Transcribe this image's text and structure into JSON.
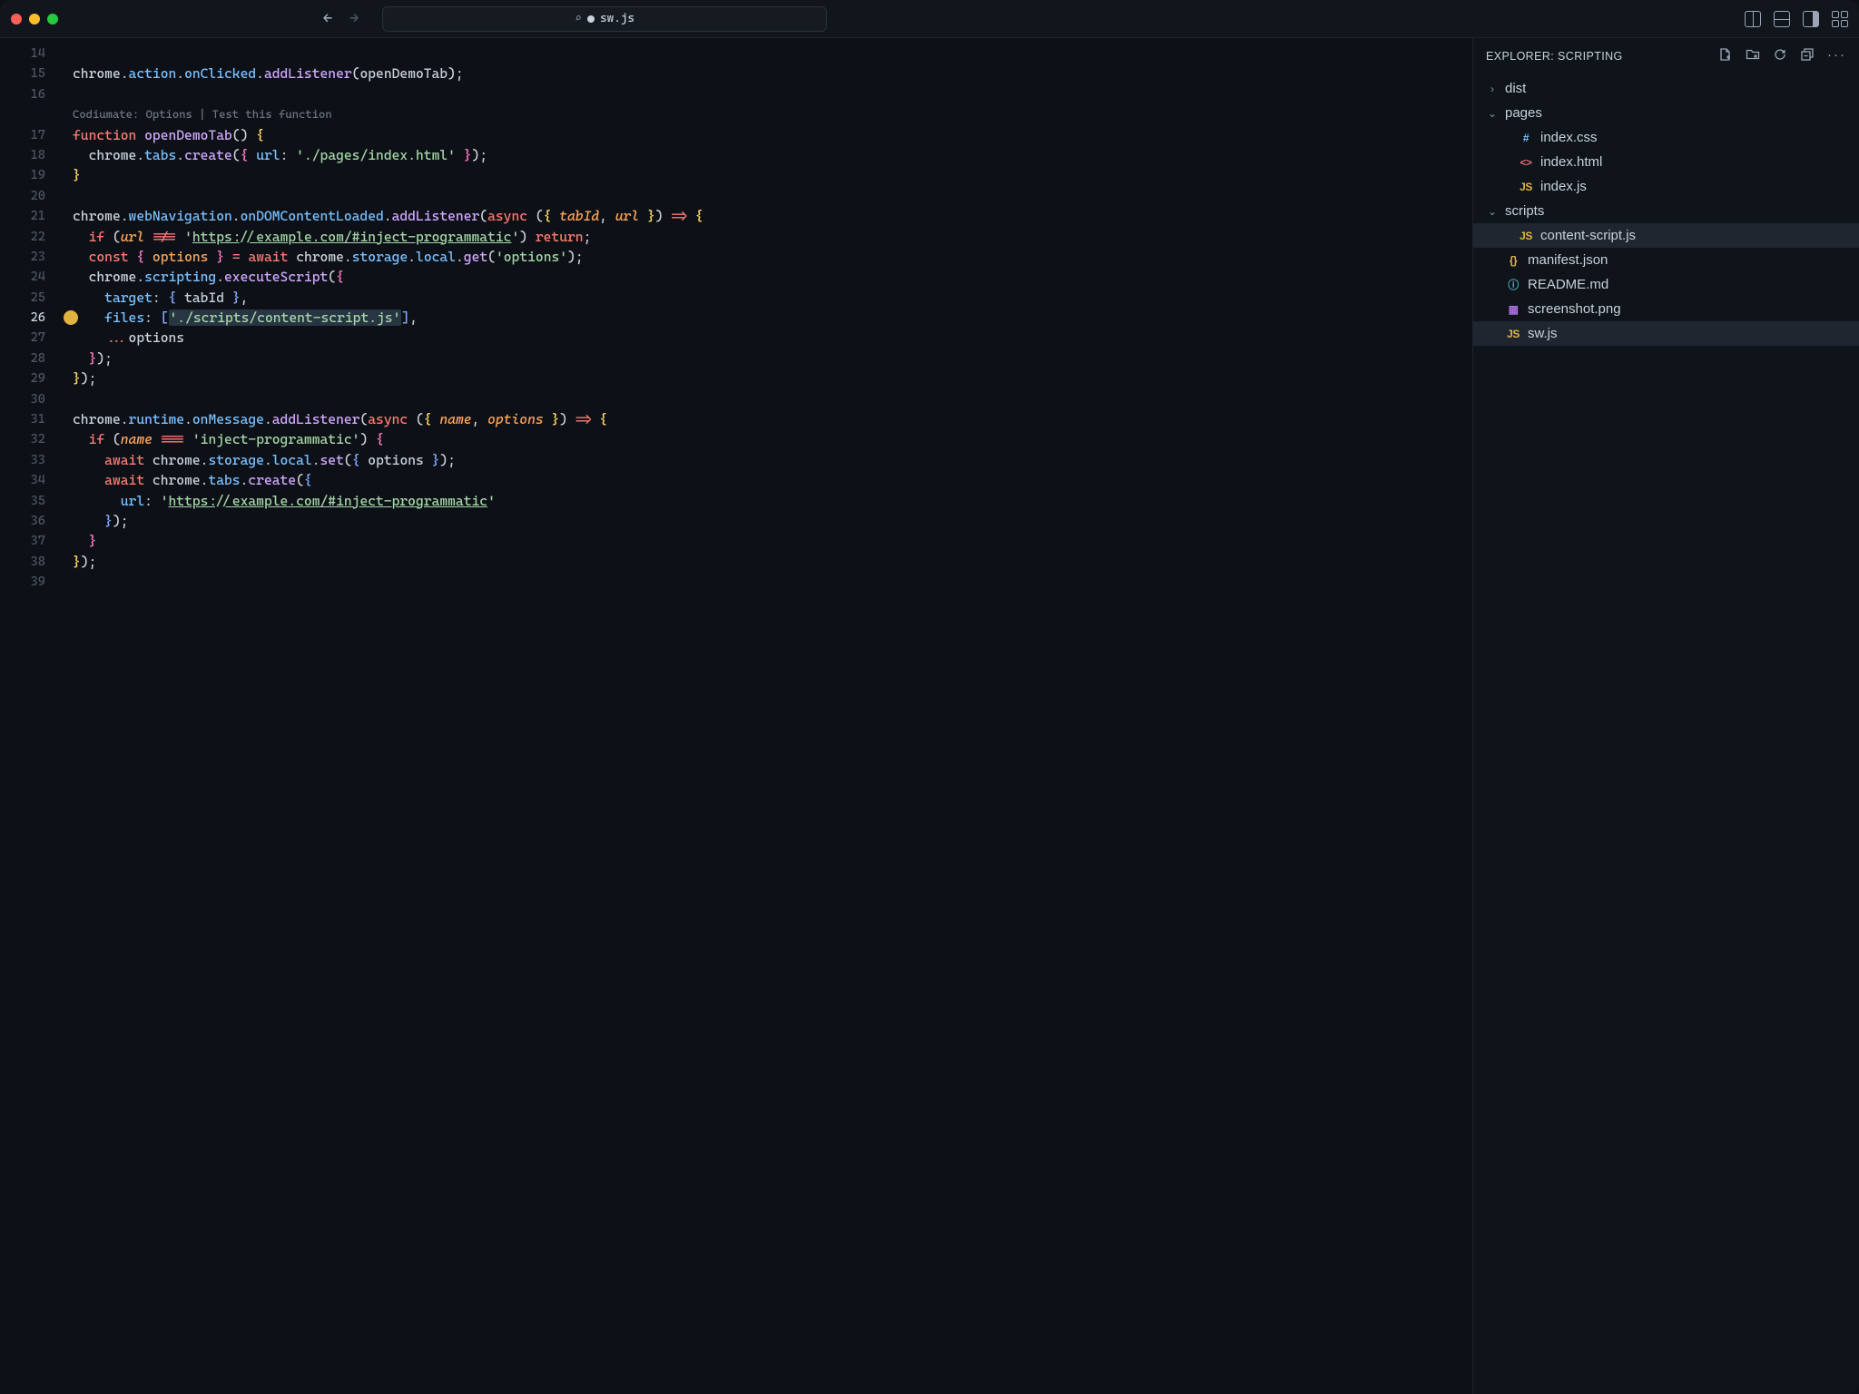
{
  "titlebar": {
    "filename": "sw.js",
    "dirty": true
  },
  "explorer": {
    "title": "EXPLORER: SCRIPTING",
    "tree": [
      {
        "type": "folder",
        "name": "dist",
        "expanded": false,
        "depth": 1
      },
      {
        "type": "folder",
        "name": "pages",
        "expanded": true,
        "depth": 1
      },
      {
        "type": "file",
        "name": "index.css",
        "icon": "css",
        "iconText": "#",
        "depth": 3
      },
      {
        "type": "file",
        "name": "index.html",
        "icon": "html",
        "iconText": "<>",
        "depth": 3
      },
      {
        "type": "file",
        "name": "index.js",
        "icon": "js",
        "iconText": "JS",
        "depth": 3
      },
      {
        "type": "folder",
        "name": "scripts",
        "expanded": true,
        "depth": 1
      },
      {
        "type": "file",
        "name": "content-script.js",
        "icon": "js",
        "iconText": "JS",
        "depth": 3,
        "selected": true
      },
      {
        "type": "file",
        "name": "manifest.json",
        "icon": "json",
        "iconText": "{}",
        "depth": 1
      },
      {
        "type": "file",
        "name": "README.md",
        "icon": "md",
        "iconText": "ⓘ",
        "depth": 1
      },
      {
        "type": "file",
        "name": "screenshot.png",
        "icon": "img",
        "iconText": "▦",
        "depth": 1
      },
      {
        "type": "file",
        "name": "sw.js",
        "icon": "js",
        "iconText": "JS",
        "depth": 1,
        "active": true
      }
    ]
  },
  "editor": {
    "startLine": 14,
    "activeLine": 26,
    "codelens": "Codiumate: Options | Test this function",
    "str_index_html": "'./pages/index.html'",
    "str_url1": "https://example.com/#inject-programmatic",
    "str_options": "'options'",
    "str_inject": "'inject-programmatic'",
    "str_content_script": "'./scripts/content-script.js'",
    "lineNumbers": [
      14,
      15,
      16,
      17,
      18,
      19,
      20,
      21,
      22,
      23,
      24,
      25,
      26,
      27,
      28,
      29,
      30,
      31,
      32,
      33,
      34,
      35,
      36,
      37,
      38,
      39
    ]
  }
}
